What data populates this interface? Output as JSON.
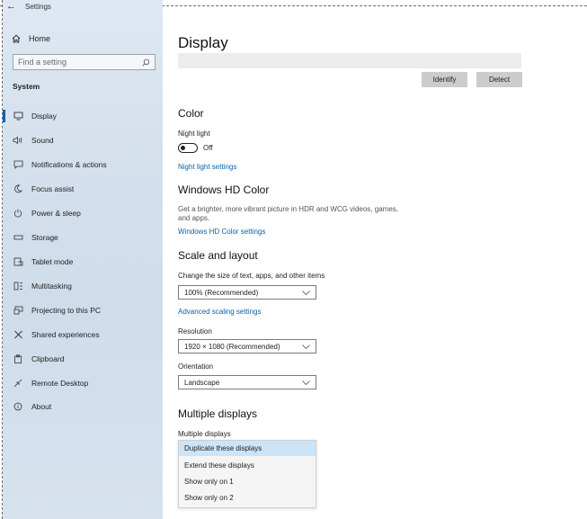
{
  "window": {
    "title": "Settings"
  },
  "sidebar": {
    "home_label": "Home",
    "search_placeholder": "Find a setting",
    "section_title": "System",
    "items": [
      {
        "label": "Display",
        "icon": "monitor-icon"
      },
      {
        "label": "Sound",
        "icon": "speaker-icon"
      },
      {
        "label": "Notifications & actions",
        "icon": "notifications-icon"
      },
      {
        "label": "Focus assist",
        "icon": "moon-icon"
      },
      {
        "label": "Power & sleep",
        "icon": "power-icon"
      },
      {
        "label": "Storage",
        "icon": "storage-icon"
      },
      {
        "label": "Tablet mode",
        "icon": "tablet-icon"
      },
      {
        "label": "Multitasking",
        "icon": "multitasking-icon"
      },
      {
        "label": "Projecting to this PC",
        "icon": "projector-icon"
      },
      {
        "label": "Shared experiences",
        "icon": "shared-icon"
      },
      {
        "label": "Clipboard",
        "icon": "clipboard-icon"
      },
      {
        "label": "Remote Desktop",
        "icon": "remote-icon"
      },
      {
        "label": "About",
        "icon": "info-icon"
      }
    ]
  },
  "main": {
    "title": "Display",
    "identify_label": "Identify",
    "detect_label": "Detect",
    "color": {
      "heading": "Color",
      "night_light_label": "Night light",
      "toggle_state": "Off",
      "settings_link": "Night light settings"
    },
    "hd_color": {
      "heading": "Windows HD Color",
      "description": "Get a brighter, more vibrant picture in HDR and WCG videos, games, and apps.",
      "settings_link": "Windows HD Color settings"
    },
    "scale": {
      "heading": "Scale and layout",
      "size_label": "Change the size of text, apps, and other items",
      "size_value": "100% (Recommended)",
      "advanced_link": "Advanced scaling settings",
      "resolution_label": "Resolution",
      "resolution_value": "1920 × 1080 (Recommended)",
      "orientation_label": "Orientation",
      "orientation_value": "Landscape"
    },
    "multiple": {
      "heading": "Multiple displays",
      "label": "Multiple displays",
      "options": [
        "Duplicate these displays",
        "Extend these displays",
        "Show only on 1",
        "Show only on 2"
      ],
      "selected_index": 0
    }
  },
  "colors": {
    "accent": "#0063b1",
    "sidebar_bg": "#d4e0ec",
    "selected_bg": "#cce4f7"
  }
}
